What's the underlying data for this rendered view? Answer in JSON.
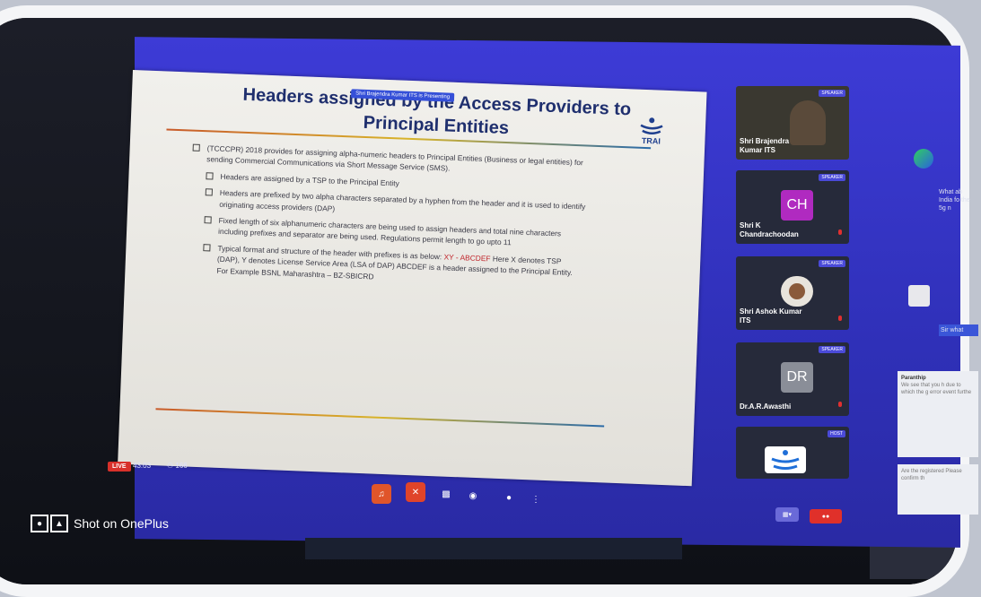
{
  "watermark": {
    "text": "Shot on OnePlus"
  },
  "slide": {
    "title_line1": "Headers assigned by the Access Providers to",
    "title_line2": "Principal Entities",
    "presenting_tag": "Shri Brajendra Kumar ITS is Presenting",
    "logo_text": "TRAI",
    "bullets": {
      "b1": "(TCCCPR) 2018 provides for assigning alpha-numeric headers to Principal Entities (Business or legal entities) for sending Commercial Communications via Short Message Service (SMS).",
      "b2": "Headers are assigned by a TSP to the Principal Entity",
      "b3": "Headers are prefixed by two alpha characters separated by a hyphen from the header and it is used to identify originating access providers (DAP)",
      "b4": "Fixed length of six alphanumeric characters are being used to assign headers and total nine characters including prefixes and separator are being used. Regulations permit length to go upto 11",
      "b5_pre": "Typical format and structure of the header with prefixes is as below:",
      "b5_red": "XY - ABCDEF",
      "b5_post": "Here X denotes TSP (DAP), Y denotes License Service Area (LSA of DAP) ABCDEF is a header assigned to the Principal Entity. For Example BSNL Maharashtra – BZ-SBICRD"
    }
  },
  "participants": [
    {
      "name": "Shri Brajendra Kumar ITS",
      "badge": "SPEAKER",
      "avatar": ""
    },
    {
      "name": "Shri K Chandrachoodan",
      "badge": "SPEAKER",
      "avatar": "CH"
    },
    {
      "name": "Shri Ashok Kumar ITS",
      "badge": "SPEAKER",
      "avatar": ""
    },
    {
      "name": "Dr.A.R.Awasthi",
      "badge": "SPEAKER",
      "avatar": "DR"
    },
    {
      "name": "",
      "badge": "HOST",
      "avatar": ""
    }
  ],
  "bottom_bar": {
    "live": "LIVE",
    "timer": "43:03",
    "viewers": "166"
  },
  "chat": {
    "msg1": "What ab India fo the 5g n",
    "msg2": "Sir what",
    "card1_name": "Paranthip",
    "card1_text": "We see that you h due to which the g error event furthe",
    "card2_text": "Are the registered Please confirm th"
  },
  "colors": {
    "app_blue": "#3d3bd6",
    "live_red": "#d8302a",
    "frame_white": "#f4f5f7"
  }
}
